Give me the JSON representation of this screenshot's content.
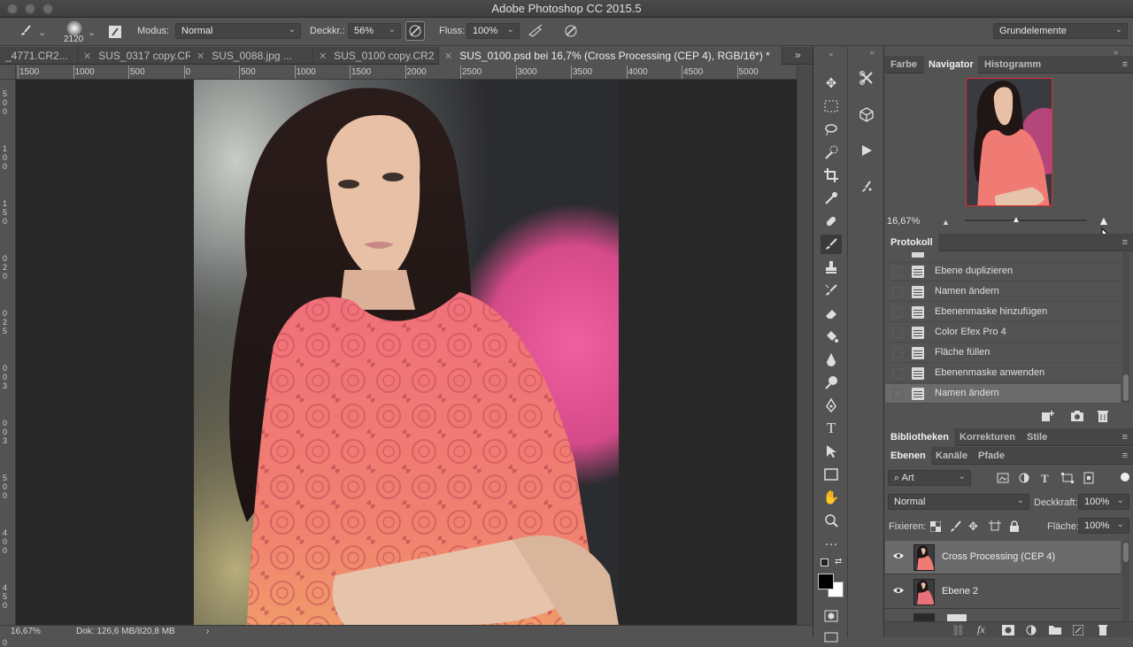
{
  "app": {
    "title": "Adobe Photoshop CC 2015.5"
  },
  "options": {
    "brush_size": "2120",
    "mode_label": "Modus:",
    "mode_value": "Normal",
    "opacity_label": "Deckkr.:",
    "opacity_value": "56%",
    "flow_label": "Fluss:",
    "flow_value": "100%",
    "workspace": "Grundelemente"
  },
  "tabs": [
    {
      "label": "_4771.CR2..."
    },
    {
      "label": "SUS_0317 copy.CR2"
    },
    {
      "label": "SUS_0088.jpg ..."
    },
    {
      "label": "SUS_0100 copy.CR2"
    },
    {
      "label": "SUS_0100.psd bei 16,7% (Cross Processing (CEP 4), RGB/16*) *"
    }
  ],
  "ruler": {
    "h_labels": [
      "1500",
      "1000",
      "500",
      "0",
      "500",
      "1000",
      "1500",
      "2000",
      "2500",
      "3000",
      "3500",
      "4000",
      "4500",
      "5000"
    ],
    "v_labels": [
      "5",
      "0",
      "0",
      "1",
      "0",
      "0",
      "1",
      "5",
      "0",
      "0",
      "2",
      "0",
      "0",
      "2",
      "5",
      "0",
      "0",
      "3",
      "0",
      "0",
      "3",
      "5",
      "0",
      "0",
      "4",
      "0",
      "0",
      "4",
      "5",
      "0",
      "0"
    ]
  },
  "status": {
    "zoom": "16,67%",
    "doc": "Dok: 126,6 MB/820,8 MB"
  },
  "panels": {
    "top_tabs": [
      "Farbe",
      "Navigator",
      "Histogramm"
    ],
    "navigator_zoom": "16,67%",
    "navigator_zoom_fraction": 0.42,
    "history_title": "Protokoll",
    "history": [
      "Ebene duplizieren",
      "Namen ändern",
      "Ebenenmaske hinzufügen",
      "Color Efex Pro 4",
      "Fläche füllen",
      "Ebenenmaske anwenden",
      "Namen ändern"
    ],
    "lib_tabs": [
      "Bibliotheken",
      "Korrekturen",
      "Stile"
    ],
    "layer_tabs": [
      "Ebenen",
      "Kanäle",
      "Pfade"
    ],
    "filter_kind": "Art",
    "blend_mode": "Normal",
    "opacity_label": "Deckkraft:",
    "opacity_value": "100%",
    "lock_label": "Fixieren:",
    "fill_label": "Fläche:",
    "fill_value": "100%",
    "layers": [
      {
        "name": "Cross Processing (CEP 4)"
      },
      {
        "name": "Ebene 2"
      }
    ]
  },
  "colors": {
    "accent": "#e0457b",
    "panel_bg": "#535353",
    "canvas_bg": "#282828"
  }
}
